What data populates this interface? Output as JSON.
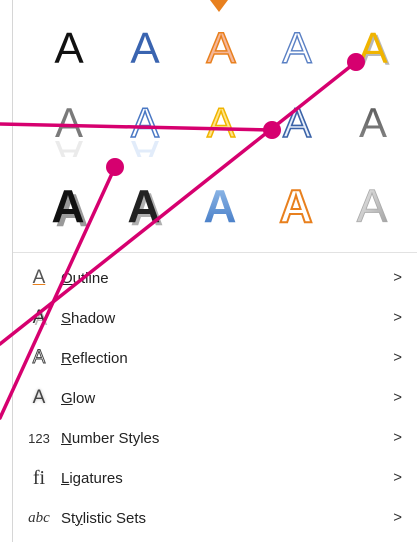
{
  "colors": {
    "accent": "#e8801e",
    "callout_line": "#d6006f"
  },
  "gallery": {
    "row1": [
      {
        "glyph": "A",
        "style": "black"
      },
      {
        "glyph": "A",
        "style": "blue"
      },
      {
        "glyph": "A",
        "style": "orange-outline-fill"
      },
      {
        "glyph": "A",
        "style": "blue-outline"
      },
      {
        "glyph": "A",
        "style": "gold-shadow"
      }
    ],
    "row2": [
      {
        "glyph": "A",
        "style": "gray-reflection"
      },
      {
        "glyph": "A",
        "style": "blue-reflection"
      },
      {
        "glyph": "A",
        "style": "yellow-glow"
      },
      {
        "glyph": "A",
        "style": "blue-bevel-outline"
      },
      {
        "glyph": "A",
        "style": "gray-gradient"
      }
    ],
    "row3": [
      {
        "glyph": "A",
        "style": "black-3d"
      },
      {
        "glyph": "A",
        "style": "black-shadow"
      },
      {
        "glyph": "A",
        "style": "blue-3d"
      },
      {
        "glyph": "A",
        "style": "orange-outline"
      },
      {
        "glyph": "A",
        "style": "silver"
      }
    ]
  },
  "menu": [
    {
      "icon": "outline-icon",
      "icon_glyph": "A",
      "mnemonic": "O",
      "rest": "utline",
      "chevron": ">"
    },
    {
      "icon": "shadow-icon",
      "icon_glyph": "A",
      "mnemonic": "S",
      "rest": "hadow",
      "chevron": ">"
    },
    {
      "icon": "reflection-icon",
      "icon_glyph": "A",
      "mnemonic": "R",
      "rest": "eflection",
      "chevron": ">"
    },
    {
      "icon": "glow-icon",
      "icon_glyph": "A",
      "mnemonic": "G",
      "rest": "low",
      "chevron": ">"
    },
    {
      "icon": "number-styles-icon",
      "icon_glyph": "123",
      "mnemonic": "N",
      "rest": "umber Styles",
      "chevron": ">"
    },
    {
      "icon": "ligatures-icon",
      "icon_glyph": "fi",
      "mnemonic": "L",
      "rest": "igatures",
      "chevron": ">"
    },
    {
      "icon": "stylistic-sets-icon",
      "icon_glyph": "abc",
      "mnemonic": "y",
      "pre": "St",
      "rest": "listic Sets",
      "chevron": ">"
    }
  ]
}
